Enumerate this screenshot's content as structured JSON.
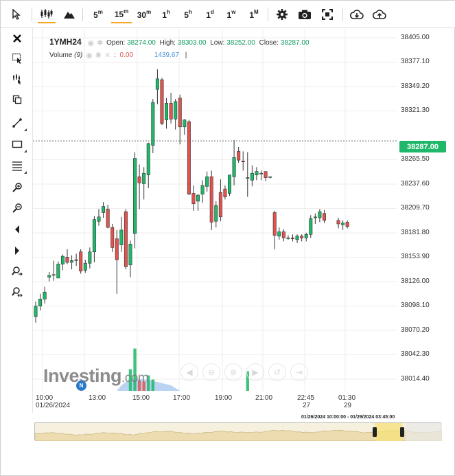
{
  "toolbar": {
    "interval_5m": "5",
    "interval_15m": "15",
    "interval_30m": "30",
    "interval_1h": "1",
    "interval_5h": "5",
    "interval_1d": "1",
    "interval_1w": "1",
    "interval_1M": "1",
    "sup_m": "m",
    "sup_h": "h",
    "sup_d": "d",
    "sup_w": "w",
    "sup_M": "M",
    "active_interval": "15m"
  },
  "legend": {
    "symbol": "1YMH24",
    "open_label": "Open:",
    "open_value": "38274.00",
    "high_label": "High:",
    "high_value": "38303.00",
    "low_label": "Low:",
    "low_value": "38252.00",
    "close_label": "Close:",
    "close_value": "38287.00",
    "volume_label": "Volume",
    "volume_param": "(9)",
    "volume_colon": ":",
    "volume_value_1": "0.00",
    "volume_value_2": "1439.67",
    "volume_bar": "|"
  },
  "price_axis": {
    "ticks": [
      "38405.00",
      "38377.10",
      "38349.20",
      "38321.30",
      "38265.50",
      "38237.60",
      "38209.70",
      "38181.80",
      "38153.90",
      "38126.00",
      "38098.10",
      "38070.20",
      "38042.30",
      "38014.40"
    ],
    "current_price": "38287.00"
  },
  "time_axis": {
    "ticks": [
      {
        "label": "10:00",
        "sub": "01/26/2024"
      },
      {
        "label": "13:00",
        "sub": ""
      },
      {
        "label": "15:00",
        "sub": ""
      },
      {
        "label": "17:00",
        "sub": ""
      },
      {
        "label": "19:00",
        "sub": ""
      },
      {
        "label": "21:00",
        "sub": ""
      },
      {
        "label": "22:45",
        "sub": "27"
      },
      {
        "label": "01:30",
        "sub": "29"
      }
    ]
  },
  "watermark": {
    "brand": "Investing",
    "suffix": ".com"
  },
  "badge": {
    "text": "N"
  },
  "navigator": {
    "range_label": "01/26/2024 10:00:00 - 01/29/2024 03:45:00"
  },
  "colors": {
    "up": "#1fb86a",
    "down": "#e2534f",
    "grid": "#eeeeee",
    "volume_area": "#a9c8ef",
    "accent": "#f5a623"
  },
  "chart_data": {
    "type": "candlestick",
    "symbol": "1YMH24",
    "ylim": [
      38001.0,
      38416.0
    ],
    "y_ticks": [
      38405.0,
      38377.1,
      38349.2,
      38321.3,
      38265.5,
      38237.6,
      38209.7,
      38181.8,
      38153.9,
      38126.0,
      38098.1,
      38070.2,
      38042.3,
      38014.4
    ],
    "current_price": 38287.0,
    "gap_after_index": 64,
    "candles": [
      {
        "o": 38086,
        "h": 38103,
        "l": 38079,
        "c": 38098
      },
      {
        "o": 38098,
        "h": 38112,
        "l": 38093,
        "c": 38106
      },
      {
        "o": 38106,
        "h": 38120,
        "l": 38101,
        "c": 38114
      },
      {
        "o": 38131,
        "h": 38137,
        "l": 38126,
        "c": 38133
      },
      {
        "o": 38134,
        "h": 38150,
        "l": 38127,
        "c": 38134
      },
      {
        "o": 38130,
        "h": 38149,
        "l": 38130,
        "c": 38146
      },
      {
        "o": 38146,
        "h": 38157,
        "l": 38139,
        "c": 38155
      },
      {
        "o": 38154,
        "h": 38163,
        "l": 38146,
        "c": 38148
      },
      {
        "o": 38148,
        "h": 38156,
        "l": 38140,
        "c": 38150
      },
      {
        "o": 38151,
        "h": 38158,
        "l": 38144,
        "c": 38150
      },
      {
        "o": 38160,
        "h": 38163,
        "l": 38135,
        "c": 38138
      },
      {
        "o": 38139,
        "h": 38151,
        "l": 38136,
        "c": 38147
      },
      {
        "o": 38147,
        "h": 38165,
        "l": 38141,
        "c": 38160
      },
      {
        "o": 38160,
        "h": 38201,
        "l": 38148,
        "c": 38197
      },
      {
        "o": 38195,
        "h": 38209,
        "l": 38190,
        "c": 38200
      },
      {
        "o": 38205,
        "h": 38217,
        "l": 38199,
        "c": 38212
      },
      {
        "o": 38209,
        "h": 38214,
        "l": 38187,
        "c": 38188
      },
      {
        "o": 38188,
        "h": 38192,
        "l": 38160,
        "c": 38165
      },
      {
        "o": 38175,
        "h": 38185,
        "l": 38112,
        "c": 38151
      },
      {
        "o": 38168,
        "h": 38200,
        "l": 38160,
        "c": 38185
      },
      {
        "o": 38206,
        "h": 38209,
        "l": 38140,
        "c": 38143
      },
      {
        "o": 38145,
        "h": 38173,
        "l": 38131,
        "c": 38169
      },
      {
        "o": 38181,
        "h": 38274,
        "l": 38164,
        "c": 38267
      },
      {
        "o": 38246,
        "h": 38260,
        "l": 38209,
        "c": 38239
      },
      {
        "o": 38238,
        "h": 38257,
        "l": 38220,
        "c": 38250
      },
      {
        "o": 38248,
        "h": 38285,
        "l": 38233,
        "c": 38284
      },
      {
        "o": 38282,
        "h": 38335,
        "l": 38273,
        "c": 38331
      },
      {
        "o": 38346,
        "h": 38369,
        "l": 38329,
        "c": 38358
      },
      {
        "o": 38357,
        "h": 38359,
        "l": 38305,
        "c": 38307
      },
      {
        "o": 38311,
        "h": 38336,
        "l": 38301,
        "c": 38330
      },
      {
        "o": 38330,
        "h": 38342,
        "l": 38307,
        "c": 38312
      },
      {
        "o": 38312,
        "h": 38335,
        "l": 38300,
        "c": 38332
      },
      {
        "o": 38336,
        "h": 38340,
        "l": 38283,
        "c": 38303
      },
      {
        "o": 38303,
        "h": 38312,
        "l": 38294,
        "c": 38311
      },
      {
        "o": 38309,
        "h": 38311,
        "l": 38225,
        "c": 38226
      },
      {
        "o": 38227,
        "h": 38236,
        "l": 38207,
        "c": 38215
      },
      {
        "o": 38218,
        "h": 38226,
        "l": 38207,
        "c": 38225
      },
      {
        "o": 38226,
        "h": 38242,
        "l": 38216,
        "c": 38236
      },
      {
        "o": 38235,
        "h": 38252,
        "l": 38229,
        "c": 38246
      },
      {
        "o": 38246,
        "h": 38253,
        "l": 38185,
        "c": 38194
      },
      {
        "o": 38195,
        "h": 38218,
        "l": 38188,
        "c": 38213
      },
      {
        "o": 38228,
        "h": 38243,
        "l": 38195,
        "c": 38200
      },
      {
        "o": 38232,
        "h": 38236,
        "l": 38220,
        "c": 38223
      },
      {
        "o": 38227,
        "h": 38248,
        "l": 38224,
        "c": 38248
      },
      {
        "o": 38246,
        "h": 38288,
        "l": 38236,
        "c": 38268
      },
      {
        "o": 38275,
        "h": 38280,
        "l": 38262,
        "c": 38265
      },
      {
        "o": 38264,
        "h": 38275,
        "l": 38253,
        "c": 38263
      },
      {
        "o": 38244,
        "h": 38274,
        "l": 38223,
        "c": 38245
      },
      {
        "o": 38242,
        "h": 38259,
        "l": 38235,
        "c": 38250
      },
      {
        "o": 38248,
        "h": 38257,
        "l": 38242,
        "c": 38252
      },
      {
        "o": 38250,
        "h": 38253,
        "l": 38242,
        "c": 38250
      },
      {
        "o": 38252,
        "h": 38252,
        "l": 38241,
        "c": 38245
      },
      {
        "o": 38246,
        "h": 38246,
        "l": 38244,
        "c": 38246
      },
      {
        "o": 38205,
        "h": 38207,
        "l": 38163,
        "c": 38179
      },
      {
        "o": 38178,
        "h": 38188,
        "l": 38174,
        "c": 38183
      },
      {
        "o": 38183,
        "h": 38186,
        "l": 38172,
        "c": 38176
      },
      {
        "o": 38176,
        "h": 38179,
        "l": 38174,
        "c": 38176
      },
      {
        "o": 38176,
        "h": 38180,
        "l": 38172,
        "c": 38175
      },
      {
        "o": 38174,
        "h": 38180,
        "l": 38170,
        "c": 38178
      },
      {
        "o": 38178,
        "h": 38180,
        "l": 38172,
        "c": 38176
      },
      {
        "o": 38176,
        "h": 38182,
        "l": 38172,
        "c": 38180
      },
      {
        "o": 38180,
        "h": 38202,
        "l": 38176,
        "c": 38198
      },
      {
        "o": 38199,
        "h": 38204,
        "l": 38192,
        "c": 38200
      },
      {
        "o": 38199,
        "h": 38209,
        "l": 38194,
        "c": 38206
      },
      {
        "o": 38204,
        "h": 38208,
        "l": 38193,
        "c": 38196
      },
      {
        "o": 38196,
        "h": 38199,
        "l": 38187,
        "c": 38192
      },
      {
        "o": 38191,
        "h": 38196,
        "l": 38185,
        "c": 38193
      },
      {
        "o": 38194,
        "h": 38196,
        "l": 38187,
        "c": 38189
      }
    ],
    "volume_bars": [
      {
        "index": 21,
        "value": 0.42,
        "up": true
      },
      {
        "index": 22,
        "value": 0.82,
        "up": true
      },
      {
        "index": 23,
        "value": 0.2,
        "up": false
      },
      {
        "index": 24,
        "value": 0.18,
        "up": false
      },
      {
        "index": 25,
        "value": 0.3,
        "up": true
      },
      {
        "index": 26,
        "value": 0.22,
        "up": true
      },
      {
        "index": 47,
        "value": 0.38,
        "up": true
      }
    ]
  }
}
